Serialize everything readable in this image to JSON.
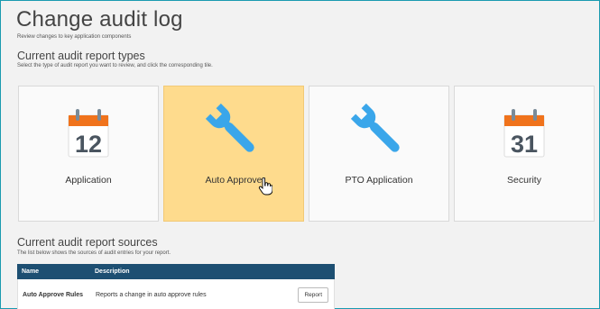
{
  "page": {
    "title": "Change audit log",
    "subtitle": "Review changes to key application components"
  },
  "types_section": {
    "title": "Current audit report types",
    "subtitle": "Select the type of audit report you want to review, and click the corresponding tile."
  },
  "tiles": [
    {
      "label": "Application",
      "icon": "calendar-icon",
      "icon_number": "12",
      "active": false
    },
    {
      "label": "Auto Approve",
      "icon": "wrench-icon",
      "active": true
    },
    {
      "label": "PTO Application",
      "icon": "wrench-icon",
      "active": false
    },
    {
      "label": "Security",
      "icon": "calendar-icon",
      "icon_number": "31",
      "active": false
    }
  ],
  "sources_section": {
    "title": "Current audit report sources",
    "subtitle": "The list below shows the sources of audit entries for your report."
  },
  "sources_table": {
    "columns": [
      "Name",
      "Description"
    ],
    "rows": [
      {
        "name": "Auto Approve Rules",
        "description": "Reports a change in auto approve rules",
        "action": "Report"
      }
    ]
  },
  "colors": {
    "accent_border": "#1a9bb0",
    "tile_active": "#fedb8d",
    "table_header": "#1d4f72",
    "calendar_orange": "#f0731c",
    "wrench_blue": "#3aa6ea"
  }
}
